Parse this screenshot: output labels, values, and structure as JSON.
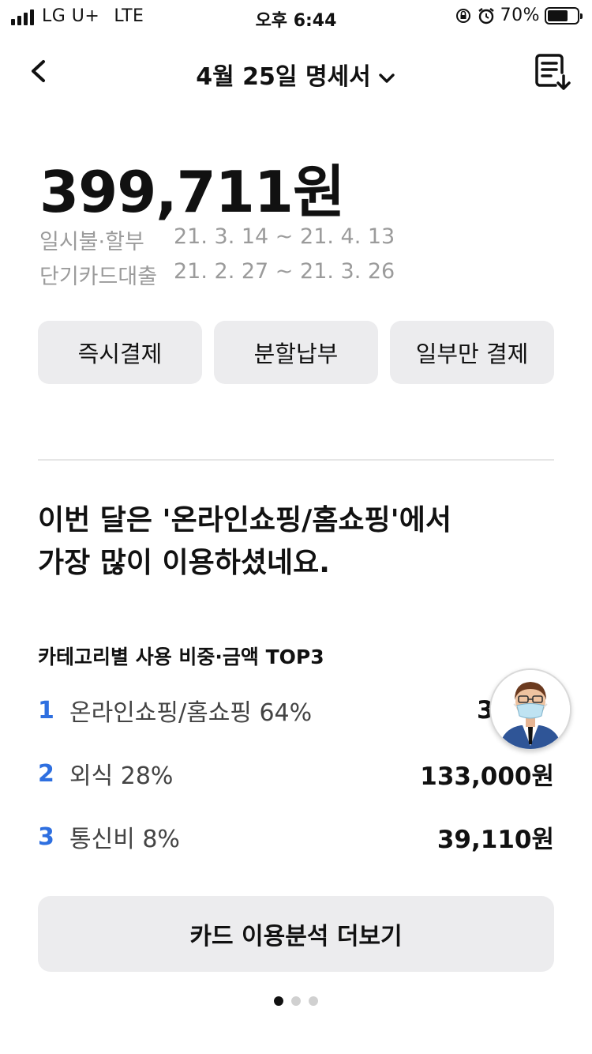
{
  "status_bar": {
    "carrier": "LG U+",
    "network": "LTE",
    "time": "오후 6:44",
    "battery": "70%",
    "battery_level": 0.7
  },
  "nav": {
    "title": "4월 25일 명세서"
  },
  "statement": {
    "amount": "399,711원",
    "periods": [
      {
        "label": "일시불·할부",
        "range": "21. 3. 14 ~ 21. 4. 13"
      },
      {
        "label": "단기카드대출",
        "range": "21. 2. 27 ~ 21. 3. 26"
      }
    ]
  },
  "actions": [
    "즉시결제",
    "분할납부",
    "일부만 결제"
  ],
  "headline": {
    "line1": "이번 달은 '온라인쇼핑/홈쇼핑'에서",
    "line2": "가장 많이 이용하셨네요."
  },
  "categories": {
    "title": "카테고리별 사용 비중·금액 TOP3",
    "items": [
      {
        "rank": "1",
        "name": "온라인쇼핑/홈쇼핑 64%",
        "amount": "306,9"
      },
      {
        "rank": "2",
        "name": "외식 28%",
        "amount": "133,000원"
      },
      {
        "rank": "3",
        "name": "통신비 8%",
        "amount": "39,110원"
      }
    ]
  },
  "more_button": "카드 이용분석 더보기",
  "pagination": {
    "pages": 3,
    "active": 1
  },
  "colors": {
    "accent": "#2e6fe0",
    "button_bg": "#ececee",
    "muted_text": "#9b9b9b"
  },
  "icons": [
    "back-arrow-icon",
    "chevron-down-icon",
    "document-download-icon",
    "orientation-lock-icon",
    "alarm-icon"
  ]
}
